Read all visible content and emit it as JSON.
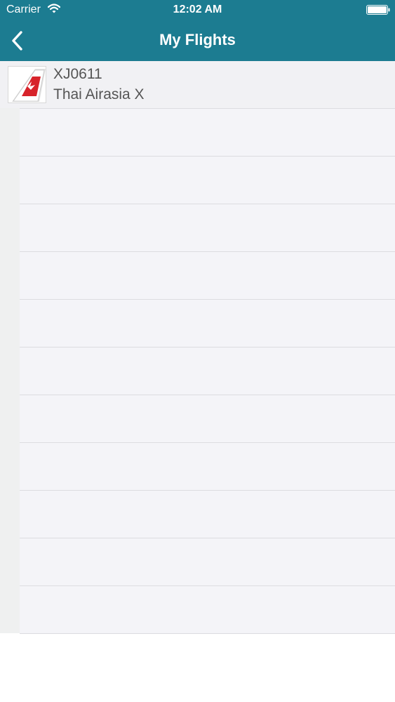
{
  "status_bar": {
    "carrier": "Carrier",
    "time": "12:02 AM",
    "wifi_icon": "wifi-icon",
    "battery_icon": "battery-full-icon"
  },
  "nav_bar": {
    "back_icon": "chevron-left-icon",
    "title": "My Flights",
    "background_color": "#1c7c91"
  },
  "flights": [
    {
      "flight_number": "XJ0611",
      "airline": "Thai Airasia X",
      "logo_icon": "airline-tail-logo-icon"
    }
  ],
  "empty_rows": 11
}
